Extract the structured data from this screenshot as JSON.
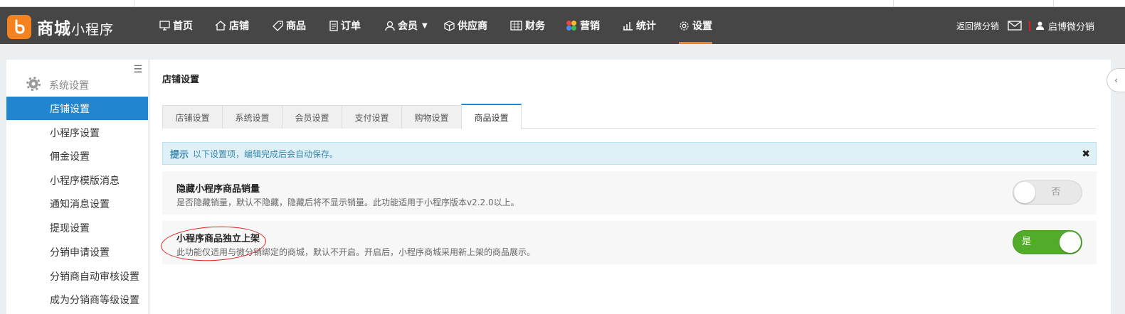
{
  "brand": {
    "name_main": "商城",
    "name_sub": "小程序",
    "accent_color": "#f5821f"
  },
  "nav": {
    "items": [
      {
        "label": "首页",
        "icon": "monitor-icon"
      },
      {
        "label": "店铺",
        "icon": "home-icon"
      },
      {
        "label": "商品",
        "icon": "tag-icon"
      },
      {
        "label": "订单",
        "icon": "document-icon"
      },
      {
        "label": "会员",
        "icon": "user-icon"
      },
      {
        "label": "供应商",
        "icon": "cube-icon"
      },
      {
        "label": "财务",
        "icon": "calculator-icon"
      },
      {
        "label": "营销",
        "icon": "colorful-blocks-icon"
      },
      {
        "label": "统计",
        "icon": "bar-chart-icon"
      },
      {
        "label": "设置",
        "icon": "gear-icon"
      }
    ],
    "active_index": 9,
    "right": {
      "return_label": "返回微分销",
      "user_label": "启博微分销"
    }
  },
  "sidebar": {
    "header": "系统设置",
    "items": [
      {
        "label": "店铺设置"
      },
      {
        "label": "小程序设置"
      },
      {
        "label": "佣金设置"
      },
      {
        "label": "小程序模版消息"
      },
      {
        "label": "通知消息设置"
      },
      {
        "label": "提现设置"
      },
      {
        "label": "分销申请设置"
      },
      {
        "label": "分销商自动审核设置"
      },
      {
        "label": "成为分销商等级设置"
      }
    ],
    "active_index": 0,
    "active_color": "#2185d0"
  },
  "main": {
    "title": "店铺设置",
    "tabs": [
      {
        "label": "店铺设置"
      },
      {
        "label": "系统设置"
      },
      {
        "label": "会员设置"
      },
      {
        "label": "支付设置"
      },
      {
        "label": "购物设置"
      },
      {
        "label": "商品设置"
      }
    ],
    "active_tab": 5,
    "alert": {
      "strong": "提示",
      "text": "以下设置项，编辑完成后会自动保存。"
    },
    "settings": [
      {
        "title": "隐藏小程序商品销量",
        "desc": "是否隐藏销量，默认不隐藏，隐藏后将不显示销量。此功能适用于小程序版本v2.2.0以上。",
        "toggle_label": "否",
        "enabled": false
      },
      {
        "title": "小程序商品独立上架",
        "desc": "此功能仅适用与微分销绑定的商城，默认不开启。开启后，小程序商城采用新上架的商品展示。",
        "toggle_label": "是",
        "enabled": true
      }
    ],
    "toggle_on_color": "#52ac2b"
  }
}
